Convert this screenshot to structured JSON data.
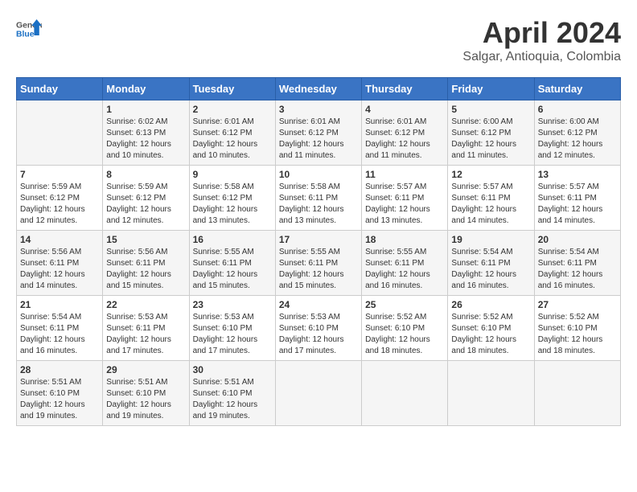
{
  "header": {
    "logo_general": "General",
    "logo_blue": "Blue",
    "title": "April 2024",
    "subtitle": "Salgar, Antioquia, Colombia"
  },
  "columns": [
    "Sunday",
    "Monday",
    "Tuesday",
    "Wednesday",
    "Thursday",
    "Friday",
    "Saturday"
  ],
  "weeks": [
    [
      {
        "day": "",
        "info": ""
      },
      {
        "day": "1",
        "info": "Sunrise: 6:02 AM\nSunset: 6:13 PM\nDaylight: 12 hours\nand 10 minutes."
      },
      {
        "day": "2",
        "info": "Sunrise: 6:01 AM\nSunset: 6:12 PM\nDaylight: 12 hours\nand 10 minutes."
      },
      {
        "day": "3",
        "info": "Sunrise: 6:01 AM\nSunset: 6:12 PM\nDaylight: 12 hours\nand 11 minutes."
      },
      {
        "day": "4",
        "info": "Sunrise: 6:01 AM\nSunset: 6:12 PM\nDaylight: 12 hours\nand 11 minutes."
      },
      {
        "day": "5",
        "info": "Sunrise: 6:00 AM\nSunset: 6:12 PM\nDaylight: 12 hours\nand 11 minutes."
      },
      {
        "day": "6",
        "info": "Sunrise: 6:00 AM\nSunset: 6:12 PM\nDaylight: 12 hours\nand 12 minutes."
      }
    ],
    [
      {
        "day": "7",
        "info": "Sunrise: 5:59 AM\nSunset: 6:12 PM\nDaylight: 12 hours\nand 12 minutes."
      },
      {
        "day": "8",
        "info": "Sunrise: 5:59 AM\nSunset: 6:12 PM\nDaylight: 12 hours\nand 12 minutes."
      },
      {
        "day": "9",
        "info": "Sunrise: 5:58 AM\nSunset: 6:12 PM\nDaylight: 12 hours\nand 13 minutes."
      },
      {
        "day": "10",
        "info": "Sunrise: 5:58 AM\nSunset: 6:11 PM\nDaylight: 12 hours\nand 13 minutes."
      },
      {
        "day": "11",
        "info": "Sunrise: 5:57 AM\nSunset: 6:11 PM\nDaylight: 12 hours\nand 13 minutes."
      },
      {
        "day": "12",
        "info": "Sunrise: 5:57 AM\nSunset: 6:11 PM\nDaylight: 12 hours\nand 14 minutes."
      },
      {
        "day": "13",
        "info": "Sunrise: 5:57 AM\nSunset: 6:11 PM\nDaylight: 12 hours\nand 14 minutes."
      }
    ],
    [
      {
        "day": "14",
        "info": "Sunrise: 5:56 AM\nSunset: 6:11 PM\nDaylight: 12 hours\nand 14 minutes."
      },
      {
        "day": "15",
        "info": "Sunrise: 5:56 AM\nSunset: 6:11 PM\nDaylight: 12 hours\nand 15 minutes."
      },
      {
        "day": "16",
        "info": "Sunrise: 5:55 AM\nSunset: 6:11 PM\nDaylight: 12 hours\nand 15 minutes."
      },
      {
        "day": "17",
        "info": "Sunrise: 5:55 AM\nSunset: 6:11 PM\nDaylight: 12 hours\nand 15 minutes."
      },
      {
        "day": "18",
        "info": "Sunrise: 5:55 AM\nSunset: 6:11 PM\nDaylight: 12 hours\nand 16 minutes."
      },
      {
        "day": "19",
        "info": "Sunrise: 5:54 AM\nSunset: 6:11 PM\nDaylight: 12 hours\nand 16 minutes."
      },
      {
        "day": "20",
        "info": "Sunrise: 5:54 AM\nSunset: 6:11 PM\nDaylight: 12 hours\nand 16 minutes."
      }
    ],
    [
      {
        "day": "21",
        "info": "Sunrise: 5:54 AM\nSunset: 6:11 PM\nDaylight: 12 hours\nand 16 minutes."
      },
      {
        "day": "22",
        "info": "Sunrise: 5:53 AM\nSunset: 6:11 PM\nDaylight: 12 hours\nand 17 minutes."
      },
      {
        "day": "23",
        "info": "Sunrise: 5:53 AM\nSunset: 6:10 PM\nDaylight: 12 hours\nand 17 minutes."
      },
      {
        "day": "24",
        "info": "Sunrise: 5:53 AM\nSunset: 6:10 PM\nDaylight: 12 hours\nand 17 minutes."
      },
      {
        "day": "25",
        "info": "Sunrise: 5:52 AM\nSunset: 6:10 PM\nDaylight: 12 hours\nand 18 minutes."
      },
      {
        "day": "26",
        "info": "Sunrise: 5:52 AM\nSunset: 6:10 PM\nDaylight: 12 hours\nand 18 minutes."
      },
      {
        "day": "27",
        "info": "Sunrise: 5:52 AM\nSunset: 6:10 PM\nDaylight: 12 hours\nand 18 minutes."
      }
    ],
    [
      {
        "day": "28",
        "info": "Sunrise: 5:51 AM\nSunset: 6:10 PM\nDaylight: 12 hours\nand 19 minutes."
      },
      {
        "day": "29",
        "info": "Sunrise: 5:51 AM\nSunset: 6:10 PM\nDaylight: 12 hours\nand 19 minutes."
      },
      {
        "day": "30",
        "info": "Sunrise: 5:51 AM\nSunset: 6:10 PM\nDaylight: 12 hours\nand 19 minutes."
      },
      {
        "day": "",
        "info": ""
      },
      {
        "day": "",
        "info": ""
      },
      {
        "day": "",
        "info": ""
      },
      {
        "day": "",
        "info": ""
      }
    ]
  ]
}
